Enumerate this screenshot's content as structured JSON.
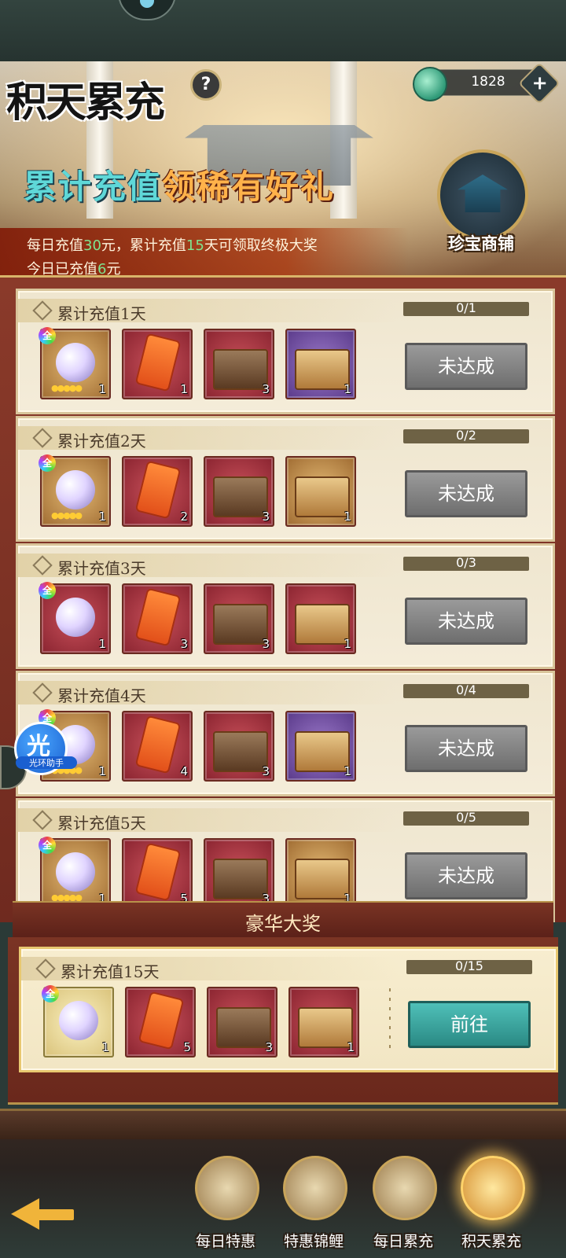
{
  "header": {
    "title": "积天累充",
    "help": "?",
    "currency_amount": "1828",
    "currency_plus": "+",
    "slogan_part1": "累计充值",
    "slogan_part2": "领稀有好礼",
    "info_line1_a": "每日充值",
    "info_line1_b": "30",
    "info_line1_c": "元，累计充值",
    "info_line1_d": "15",
    "info_line1_e": "天可领取终极大奖",
    "info_line2_a": "今日已充值",
    "info_line2_b": "6",
    "info_line2_c": "元",
    "shop_label": "珍宝商铺"
  },
  "tiers": [
    {
      "title": "累计充值1天",
      "progress_text": "0/1",
      "progress": 0,
      "button": "未达成",
      "item_counts": [
        "1",
        "1",
        "3",
        "1"
      ]
    },
    {
      "title": "累计充值2天",
      "progress_text": "0/2",
      "progress": 0,
      "button": "未达成",
      "item_counts": [
        "1",
        "2",
        "3",
        "1"
      ]
    },
    {
      "title": "累计充值3天",
      "progress_text": "0/3",
      "progress": 0,
      "button": "未达成",
      "item_counts": [
        "1",
        "3",
        "3",
        "1"
      ]
    },
    {
      "title": "累计充值4天",
      "progress_text": "0/4",
      "progress": 0,
      "button": "未达成",
      "item_counts": [
        "1",
        "4",
        "3",
        "1"
      ]
    },
    {
      "title": "累计充值5天",
      "progress_text": "0/5",
      "progress": 0,
      "button": "未达成",
      "item_counts": [
        "1",
        "5",
        "3",
        "1"
      ]
    }
  ],
  "grand_prize": {
    "heading": "豪华大奖",
    "title": "累计充值15天",
    "progress_text": "0/15",
    "progress": 0,
    "button": "前往",
    "item_counts": [
      "1",
      "5",
      "3",
      "1"
    ]
  },
  "item_badge": "全",
  "assistant": {
    "glyph": "光",
    "name": "光环助手"
  },
  "bottom_nav": [
    {
      "label": "每日特惠",
      "active": false
    },
    {
      "label": "特惠锦鲤",
      "active": false
    },
    {
      "label": "每日累充",
      "active": false
    },
    {
      "label": "积天累充",
      "active": true
    }
  ],
  "colors": {
    "highlight_green": "#7fe38f",
    "goto_teal": "#2a8a84",
    "frame_red": "#7a3424"
  }
}
